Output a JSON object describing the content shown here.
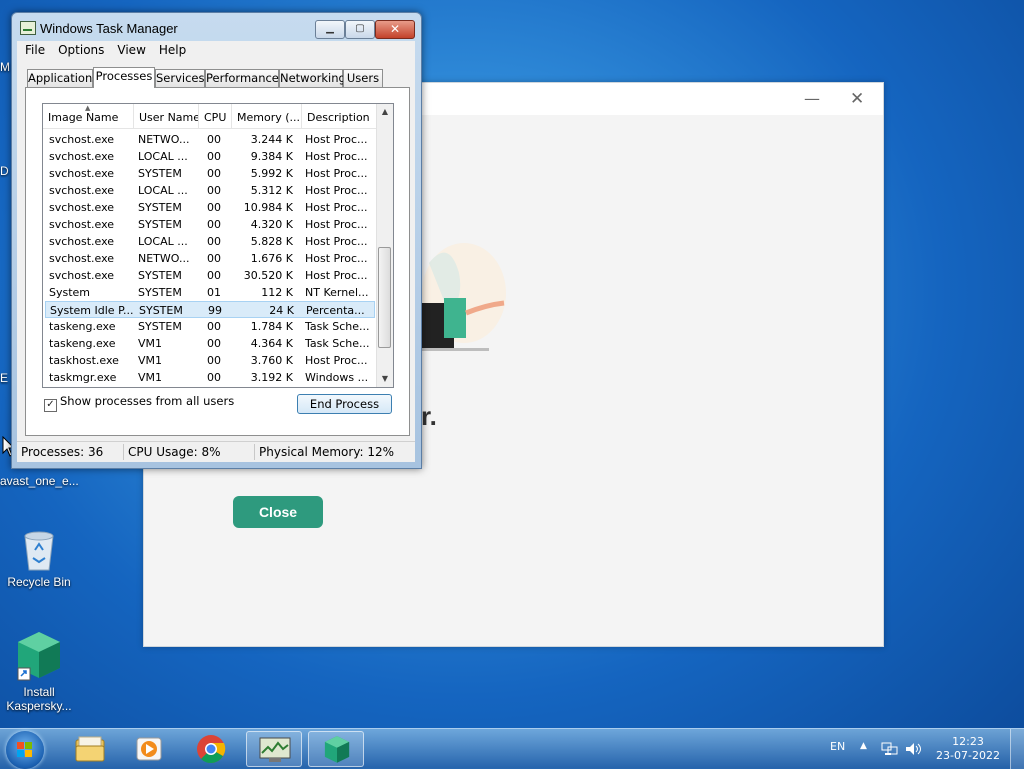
{
  "desktop": {
    "edge_letters": [
      "M",
      "D",
      "E"
    ],
    "icons": [
      {
        "label": "avast_one_e..."
      },
      {
        "label": "Recycle Bin"
      },
      {
        "label": "Install Kaspersky..."
      }
    ]
  },
  "background_window": {
    "close_button_label": "Close",
    "partial_text": "r."
  },
  "task_manager": {
    "title": "Windows Task Manager",
    "menu": [
      "File",
      "Options",
      "View",
      "Help"
    ],
    "tabs": [
      "Applications",
      "Processes",
      "Services",
      "Performance",
      "Networking",
      "Users"
    ],
    "active_tab": "Processes",
    "columns": [
      "Image Name",
      "User Name",
      "CPU",
      "Memory (...",
      "Description"
    ],
    "rows": [
      {
        "name": "svchost.exe",
        "user": "NETWO...",
        "cpu": "00",
        "mem": "3.244 K",
        "desc": "Host Proc..."
      },
      {
        "name": "svchost.exe",
        "user": "LOCAL ...",
        "cpu": "00",
        "mem": "9.384 K",
        "desc": "Host Proc..."
      },
      {
        "name": "svchost.exe",
        "user": "SYSTEM",
        "cpu": "00",
        "mem": "5.992 K",
        "desc": "Host Proc..."
      },
      {
        "name": "svchost.exe",
        "user": "LOCAL ...",
        "cpu": "00",
        "mem": "5.312 K",
        "desc": "Host Proc..."
      },
      {
        "name": "svchost.exe",
        "user": "SYSTEM",
        "cpu": "00",
        "mem": "10.984 K",
        "desc": "Host Proc..."
      },
      {
        "name": "svchost.exe",
        "user": "SYSTEM",
        "cpu": "00",
        "mem": "4.320 K",
        "desc": "Host Proc..."
      },
      {
        "name": "svchost.exe",
        "user": "LOCAL ...",
        "cpu": "00",
        "mem": "5.828 K",
        "desc": "Host Proc..."
      },
      {
        "name": "svchost.exe",
        "user": "NETWO...",
        "cpu": "00",
        "mem": "1.676 K",
        "desc": "Host Proc..."
      },
      {
        "name": "svchost.exe",
        "user": "SYSTEM",
        "cpu": "00",
        "mem": "30.520 K",
        "desc": "Host Proc..."
      },
      {
        "name": "System",
        "user": "SYSTEM",
        "cpu": "01",
        "mem": "112 K",
        "desc": "NT Kernel..."
      },
      {
        "name": "System Idle P...",
        "user": "SYSTEM",
        "cpu": "99",
        "mem": "24 K",
        "desc": "Percenta...",
        "selected": true
      },
      {
        "name": "taskeng.exe",
        "user": "SYSTEM",
        "cpu": "00",
        "mem": "1.784 K",
        "desc": "Task Sche..."
      },
      {
        "name": "taskeng.exe",
        "user": "VM1",
        "cpu": "00",
        "mem": "4.364 K",
        "desc": "Task Sche..."
      },
      {
        "name": "taskhost.exe",
        "user": "VM1",
        "cpu": "00",
        "mem": "3.760 K",
        "desc": "Host Proc..."
      },
      {
        "name": "taskmgr.exe",
        "user": "VM1",
        "cpu": "00",
        "mem": "3.192 K",
        "desc": "Windows ..."
      }
    ],
    "show_all_label": "Show processes from all users",
    "show_all_checked": "✓",
    "end_process_label": "End Process",
    "status": {
      "processes": "Processes: 36",
      "cpu": "CPU Usage: 8%",
      "memory": "Physical Memory: 12%"
    }
  },
  "taskbar": {
    "language": "EN",
    "time": "12:23",
    "date": "23-07-2022"
  }
}
